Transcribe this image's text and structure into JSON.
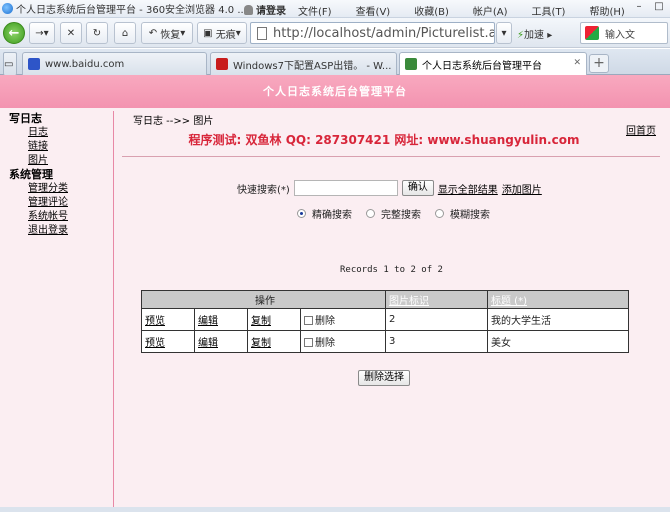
{
  "browser": {
    "window_title": "个人日志系统后台管理平台 - 360安全浏览器 4.0 ...",
    "login_label": "请登录",
    "menu": [
      "文件(F)",
      "查看(V)",
      "收藏(B)",
      "帐户(A)",
      "工具(T)",
      "帮助(H)"
    ],
    "restore_label": "恢复",
    "adblock_label": "无痕",
    "address": "http://localhost/admin/Picturelist.asp?cme",
    "speed_label": "加速",
    "search_placeholder": "输入文",
    "tabs": [
      {
        "label": "www.baidu.com",
        "active": false
      },
      {
        "label": "Windows7下配置ASP出错。 - W...",
        "active": false
      },
      {
        "label": "个人日志系统后台管理平台",
        "active": true
      }
    ],
    "new_tab_label": "+"
  },
  "page": {
    "header_title": "个人日志系统后台管理平台",
    "home_link": "回首页",
    "breadcrumb": "写日志 -->> 图片",
    "test_line": "程序测试: 双鱼林  QQ: 287307421  网址: www.shuangyulin.com"
  },
  "sidebar": {
    "group1": "写日志",
    "group1_items": [
      "日志",
      "链接",
      "图片"
    ],
    "group2": "系统管理",
    "group2_items": [
      "管理分类",
      "管理评论",
      "系统帐号",
      "退出登录"
    ]
  },
  "search": {
    "label": "快速搜索(*)",
    "input_value": "",
    "confirm_label": "确认",
    "show_all_label": "显示全部结果",
    "add_picture_label": "添加图片",
    "modes": [
      {
        "label": "精确搜索",
        "checked": true
      },
      {
        "label": "完整搜索",
        "checked": false
      },
      {
        "label": "模糊搜索",
        "checked": false
      }
    ]
  },
  "records_text": "Records 1 to 2 of 2",
  "table": {
    "header_ops": "操作",
    "header_id": "图片标识",
    "header_title": "标题 (*)",
    "row_actions": [
      "预览",
      "编辑",
      "复制"
    ],
    "delete_label": "删除",
    "rows": [
      {
        "id": "2",
        "title": "我的大学生活"
      },
      {
        "id": "3",
        "title": "美女"
      }
    ]
  },
  "delete_selected_label": "删除选择"
}
